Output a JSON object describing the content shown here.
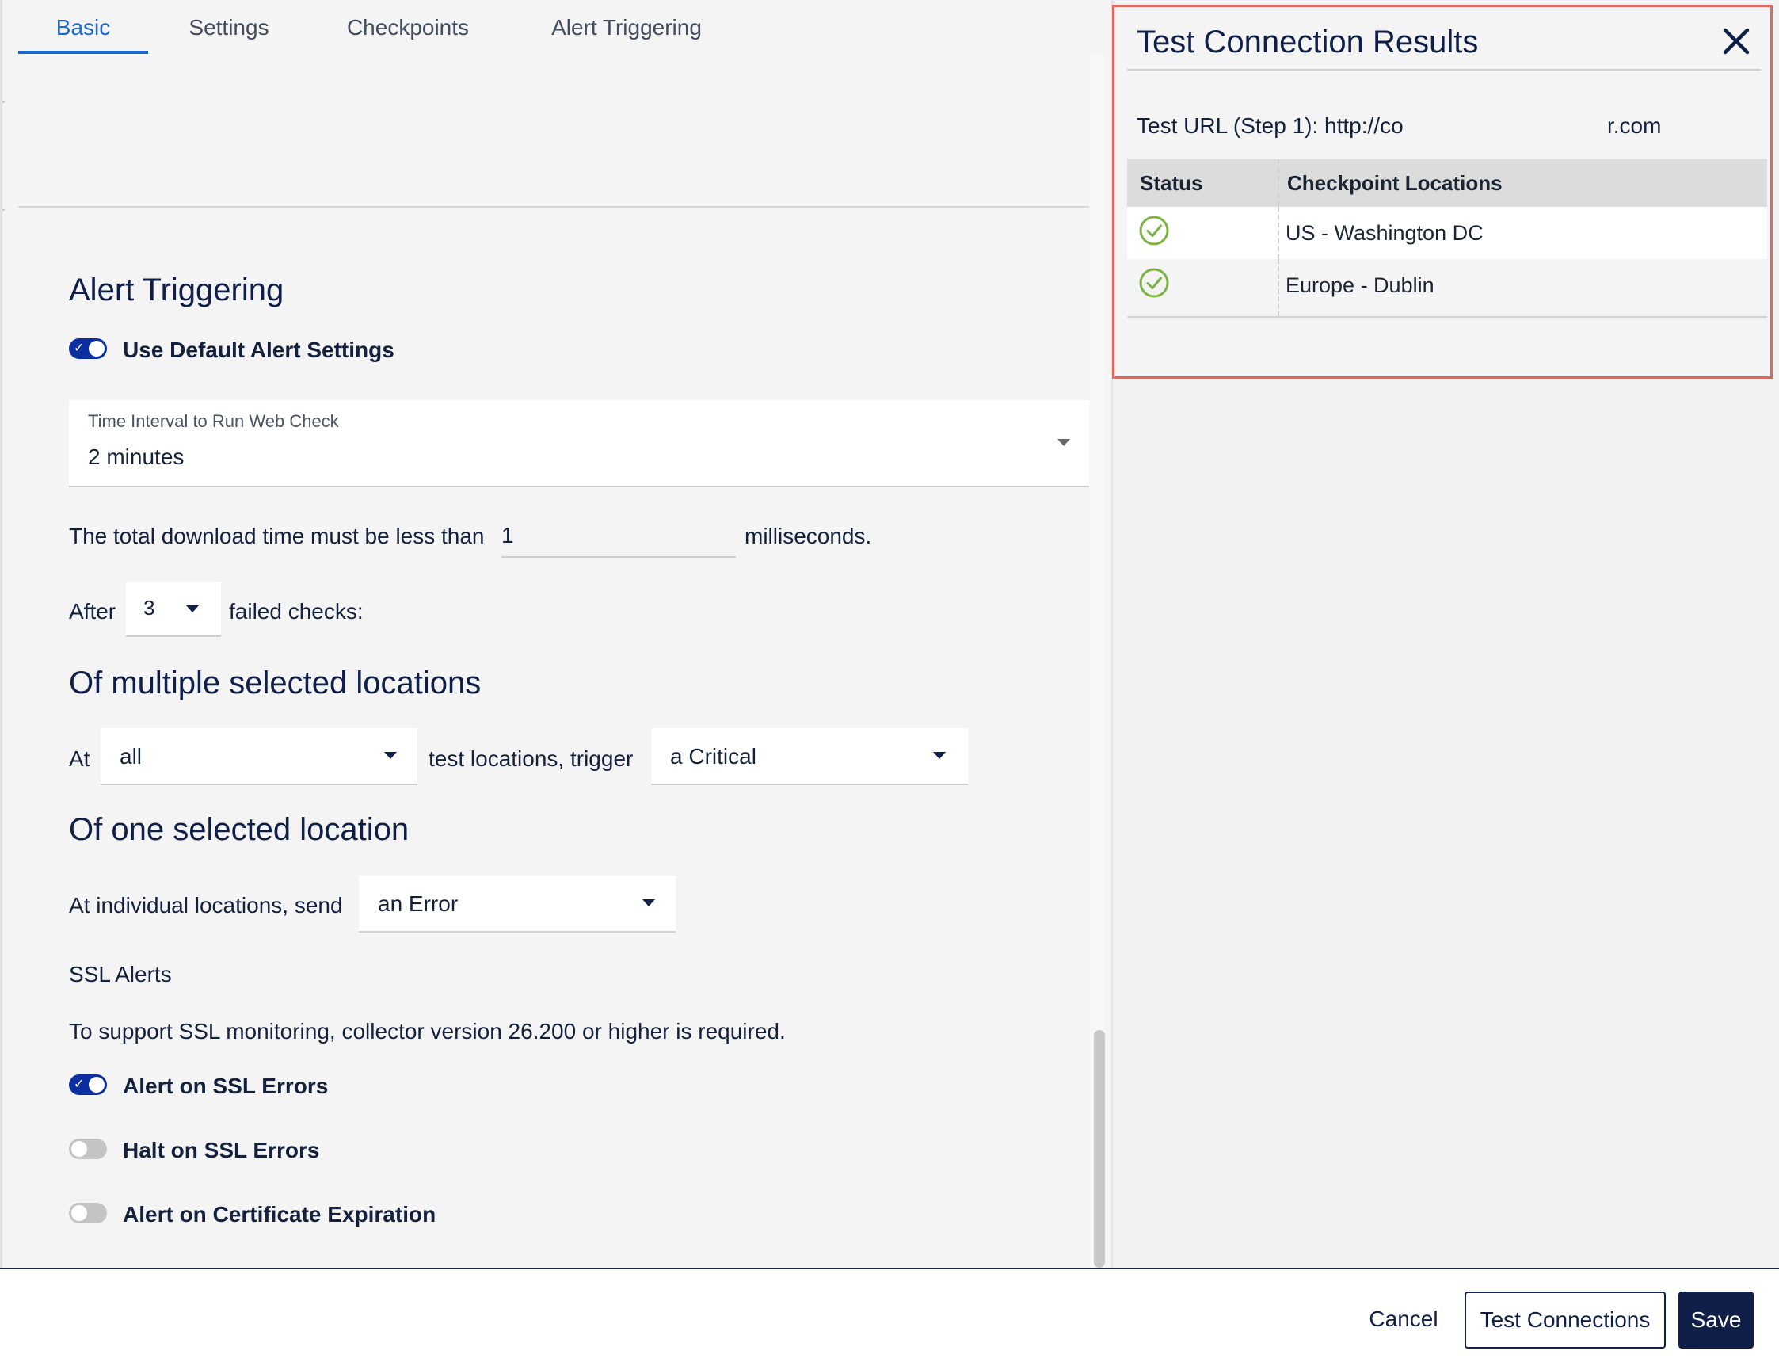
{
  "tabs": [
    {
      "label": "Basic",
      "active": true
    },
    {
      "label": "Settings",
      "active": false
    },
    {
      "label": "Checkpoints",
      "active": false
    },
    {
      "label": "Alert Triggering",
      "active": false
    }
  ],
  "alert_triggering": {
    "heading": "Alert Triggering",
    "use_default_label": "Use Default Alert Settings",
    "use_default_on": true,
    "interval": {
      "label": "Time Interval to Run Web Check",
      "value": "2 minutes"
    },
    "download_prefix": "The total download time must be less than",
    "download_value": "1",
    "download_suffix": "milliseconds.",
    "after_label": "After",
    "failed_checks_value": "3",
    "failed_checks_suffix": "failed checks:"
  },
  "multiple_locations": {
    "heading": "Of multiple selected locations",
    "at_label": "At",
    "locations_value": "all",
    "middle_label": "test locations, trigger",
    "severity_value": "a Critical"
  },
  "one_location": {
    "heading": "Of one selected location",
    "label": "At individual locations, send",
    "severity_value": "an Error"
  },
  "ssl": {
    "heading": "SSL Alerts",
    "note": "To support SSL monitoring, collector version 26.200 or higher is required.",
    "toggles": [
      {
        "label": "Alert on SSL Errors",
        "on": true
      },
      {
        "label": "Halt on SSL Errors",
        "on": false
      },
      {
        "label": "Alert on Certificate Expiration",
        "on": false
      }
    ]
  },
  "results": {
    "title": "Test Connection Results",
    "test_url_prefix": "Test URL (Step 1): http://co",
    "test_url_suffix": "r.com",
    "columns": [
      "Status",
      "Checkpoint Locations"
    ],
    "rows": [
      {
        "status": "success",
        "location": "US - Washington DC"
      },
      {
        "status": "success",
        "location": "Europe - Dublin"
      }
    ]
  },
  "footer": {
    "cancel_label": "Cancel",
    "test_label": "Test Connections",
    "save_label": "Save"
  },
  "colors": {
    "accent": "#1967d2",
    "navy": "#0f1f48",
    "toggle_on": "#0b2fa0",
    "success": "#7cb342",
    "highlight_border": "#e8655e"
  },
  "icons": {
    "close": "close-icon",
    "status_ok": "check-circle-icon",
    "dropdown": "chevron-down-icon"
  }
}
